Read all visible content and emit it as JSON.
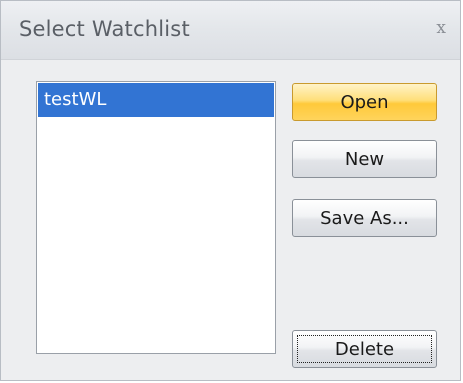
{
  "window": {
    "title": "Select Watchlist",
    "close_glyph": "x"
  },
  "watchlists": {
    "items": [
      "testWL"
    ],
    "selected": "testWL"
  },
  "buttons": {
    "open": "Open",
    "new": "New",
    "save_as": "Save As...",
    "delete": "Delete"
  },
  "colors": {
    "selection": "#3274d3",
    "primary_button": "#ffd45c"
  }
}
